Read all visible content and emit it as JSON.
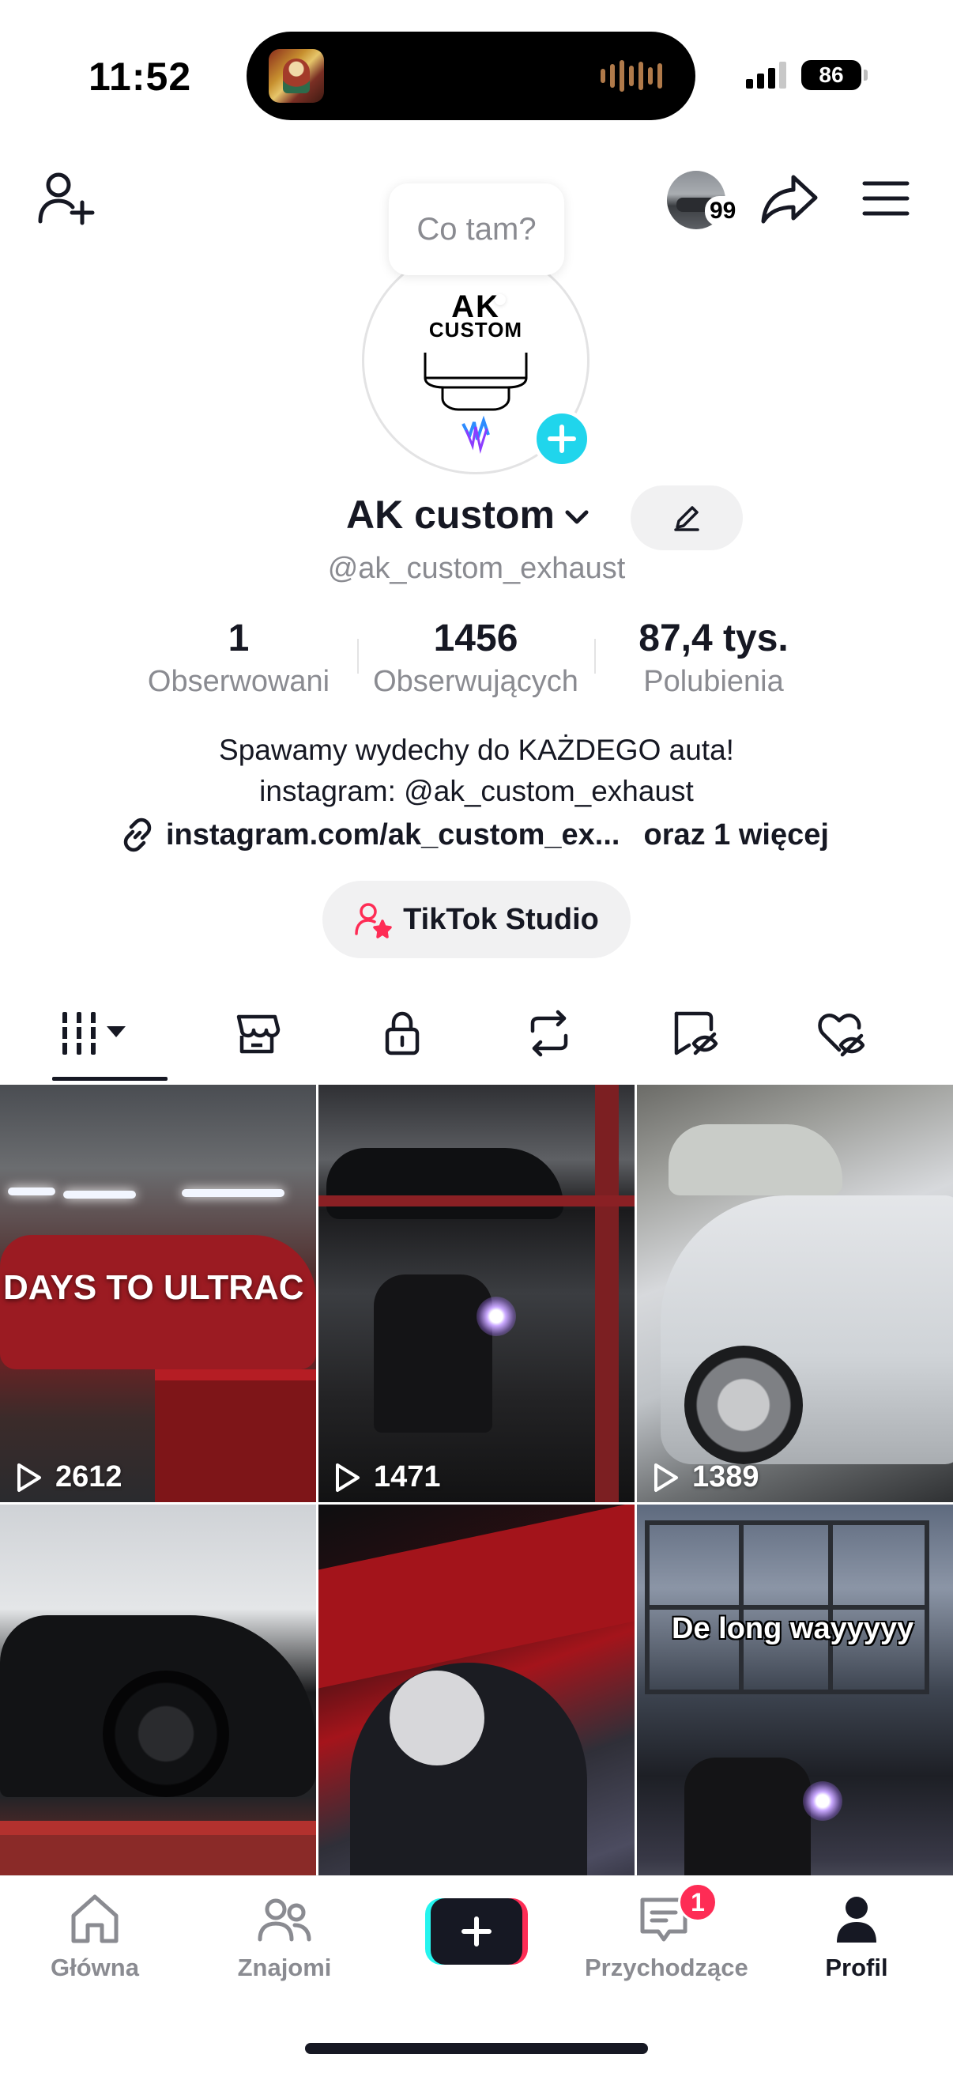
{
  "status_bar": {
    "time": "11:52",
    "battery": "86"
  },
  "header": {
    "story_count": "99",
    "status_bubble": "Co tam?"
  },
  "avatar": {
    "logo_line1": "AK",
    "logo_line2": "CUSTOM"
  },
  "profile": {
    "name": "AK custom",
    "handle": "@ak_custom_exhaust"
  },
  "stats": [
    {
      "value": "1",
      "label": "Obserwowani"
    },
    {
      "value": "1456",
      "label": "Obserwujących"
    },
    {
      "value": "87,4 tys.",
      "label": "Polubienia"
    }
  ],
  "bio": {
    "line1": "Spawamy wydechy do KAŻDEGO auta!",
    "line2": "instagram: @ak_custom_exhaust",
    "link": "instagram.com/ak_custom_ex...",
    "more": "oraz 1 więcej"
  },
  "studio_button": "TikTok Studio",
  "tabs": [
    "videos-grid-icon",
    "shop-icon",
    "lock-icon",
    "repost-icon",
    "tagged-icon",
    "liked-icon"
  ],
  "videos": [
    {
      "views": "2612",
      "overlay": "DAYS TO ULTRAC"
    },
    {
      "views": "1471",
      "overlay": ""
    },
    {
      "views": "1389",
      "overlay": ""
    },
    {
      "views": "",
      "overlay": ""
    },
    {
      "views": "",
      "overlay": ""
    },
    {
      "views": "",
      "overlay": "De long wayyyyy"
    }
  ],
  "bottom_nav": {
    "home": "Główna",
    "friends": "Znajomi",
    "inbox": "Przychodzące",
    "inbox_badge": "1",
    "profile": "Profil"
  },
  "colors": {
    "accent_cyan": "#20d5ec",
    "brand_pink": "#fe2c55",
    "text": "#161823",
    "muted": "#8a8b91"
  }
}
